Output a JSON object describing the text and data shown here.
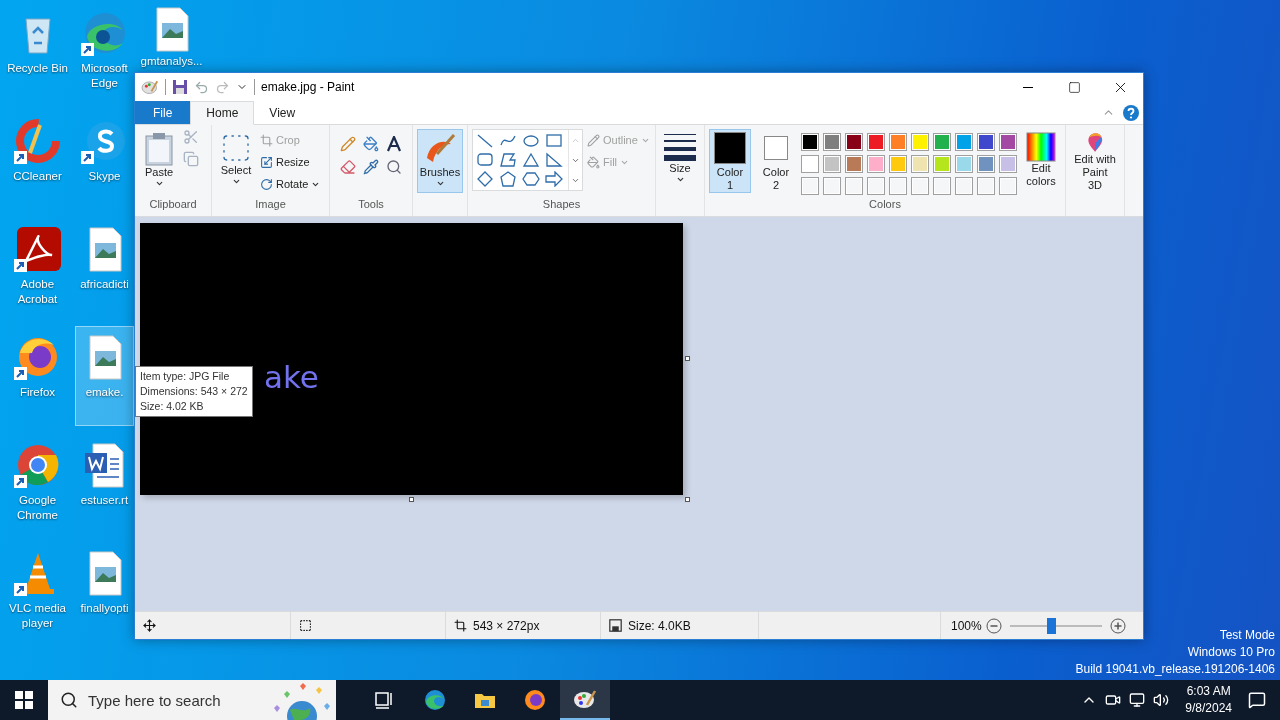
{
  "desktop": {
    "columns": [
      {
        "icons": [
          {
            "label": "Recycle Bin",
            "kind": "recycle",
            "shortcut": false,
            "selected": false
          },
          {
            "label": "CCleaner",
            "kind": "ccleaner",
            "shortcut": true,
            "selected": false
          },
          {
            "label": "Adobe Acrobat",
            "kind": "acrobat",
            "shortcut": true,
            "selected": false
          },
          {
            "label": "Firefox",
            "kind": "firefox",
            "shortcut": true,
            "selected": false
          },
          {
            "label": "Google Chrome",
            "kind": "chrome",
            "shortcut": true,
            "selected": false
          },
          {
            "label": "VLC media player",
            "kind": "vlc",
            "shortcut": true,
            "selected": false
          }
        ]
      },
      {
        "icons": [
          {
            "label": "Microsoft Edge",
            "kind": "edge",
            "shortcut": true,
            "selected": false
          },
          {
            "label": "Skype",
            "kind": "skype",
            "shortcut": true,
            "selected": false
          },
          {
            "label": "africadicti",
            "kind": "image",
            "shortcut": false,
            "selected": false
          },
          {
            "label": "emake.",
            "kind": "image",
            "shortcut": false,
            "selected": true
          },
          {
            "label": "estuser.rt",
            "kind": "word",
            "shortcut": false,
            "selected": false
          },
          {
            "label": "finallyopti",
            "kind": "image",
            "shortcut": false,
            "selected": false
          }
        ]
      },
      {
        "icons": [
          {
            "label": "gmtanalys...",
            "kind": "image",
            "shortcut": false,
            "selected": false
          }
        ]
      }
    ],
    "os_notice": [
      "Test Mode",
      "Windows 10 Pro",
      "Build 19041.vb_release.191206-1406"
    ]
  },
  "tooltip": {
    "lines": [
      "Item type: JPG File",
      "Dimensions: 543 × 272",
      "Size: 4.02 KB"
    ]
  },
  "window": {
    "title": "emake.jpg - Paint",
    "tabs": [
      {
        "label": "File",
        "kind": "file",
        "selected": false
      },
      {
        "label": "Home",
        "kind": "tab",
        "selected": true
      },
      {
        "label": "View",
        "kind": "tab",
        "selected": false
      }
    ],
    "ribbon": {
      "clipboard": {
        "label": "Clipboard",
        "paste": {
          "label": "Paste"
        },
        "cut": {
          "disabled": true
        },
        "copy": {
          "disabled": true
        }
      },
      "image": {
        "label": "Image",
        "select": {
          "label": "Select"
        },
        "crop": {
          "label": "Crop",
          "disabled": true
        },
        "resize": {
          "label": "Resize",
          "disabled": false
        },
        "rotate": {
          "label": "Rotate",
          "disabled": false
        }
      },
      "tools": {
        "label": "Tools"
      },
      "brushes": {
        "label": "Brushes",
        "selected": true
      },
      "shapes": {
        "label": "Shapes",
        "outline": {
          "label": "Outline",
          "disabled": true
        },
        "fill": {
          "label": "Fill",
          "disabled": true
        }
      },
      "size": {
        "label": "Size"
      },
      "colors": {
        "label": "Colors",
        "color1": {
          "label": "Color 1",
          "selected": true,
          "color": "#000000"
        },
        "color2": {
          "label": "Color 2",
          "selected": false,
          "color": "#ffffff"
        },
        "palette": [
          {
            "kind": "swatch",
            "color": "#000000"
          },
          {
            "kind": "swatch",
            "color": "#7f7f7f"
          },
          {
            "kind": "swatch",
            "color": "#880015"
          },
          {
            "kind": "swatch",
            "color": "#ed1c24"
          },
          {
            "kind": "swatch",
            "color": "#ff7f27"
          },
          {
            "kind": "swatch",
            "color": "#fff200"
          },
          {
            "kind": "swatch",
            "color": "#22b14c"
          },
          {
            "kind": "swatch",
            "color": "#00a2e8"
          },
          {
            "kind": "swatch",
            "color": "#3f48cc"
          },
          {
            "kind": "swatch",
            "color": "#a349a4"
          },
          {
            "kind": "swatch",
            "color": "#ffffff"
          },
          {
            "kind": "swatch",
            "color": "#c3c3c3"
          },
          {
            "kind": "swatch",
            "color": "#b97a57"
          },
          {
            "kind": "swatch",
            "color": "#ffaec9"
          },
          {
            "kind": "swatch",
            "color": "#ffc90e"
          },
          {
            "kind": "swatch",
            "color": "#efe4b0"
          },
          {
            "kind": "swatch",
            "color": "#b5e61d"
          },
          {
            "kind": "swatch",
            "color": "#99d9ea"
          },
          {
            "kind": "swatch",
            "color": "#7092be"
          },
          {
            "kind": "swatch",
            "color": "#c8bfe7"
          },
          {
            "kind": "empty"
          },
          {
            "kind": "empty"
          },
          {
            "kind": "empty"
          },
          {
            "kind": "empty"
          },
          {
            "kind": "empty"
          },
          {
            "kind": "empty"
          },
          {
            "kind": "empty"
          },
          {
            "kind": "empty"
          },
          {
            "kind": "empty"
          },
          {
            "kind": "empty"
          }
        ],
        "edit_colors": {
          "label": "Edit colors"
        }
      },
      "paint3d": {
        "label": "Edit with Paint 3D"
      }
    },
    "canvas": {
      "image_text": "ake"
    },
    "status_bar": {
      "dimensions": "543 × 272px",
      "size": "Size: 4.0KB",
      "zoom": "100%",
      "zoom_slider": {
        "level": 0.45
      }
    }
  },
  "taskbar": {
    "search": {
      "placeholder": "Type here to search"
    },
    "apps": [
      {
        "kind": "taskview",
        "selected": false
      },
      {
        "kind": "edge",
        "selected": false
      },
      {
        "kind": "explorer",
        "selected": false
      },
      {
        "kind": "firefox",
        "selected": false
      },
      {
        "kind": "paint",
        "selected": true
      }
    ],
    "clock": {
      "time": "6:03 AM",
      "date": "9/8/2024"
    }
  }
}
